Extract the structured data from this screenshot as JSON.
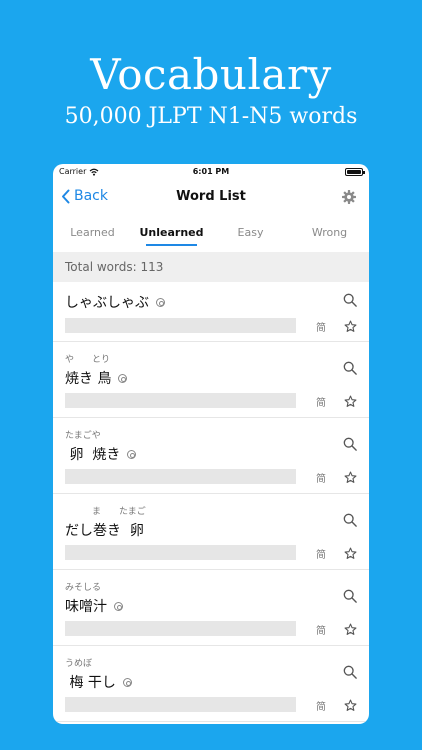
{
  "hero": {
    "title": "Vocabulary",
    "subtitle": "50,000 JLPT N1-N5 words"
  },
  "status": {
    "carrier": "Carrier",
    "time": "6:01 PM"
  },
  "navbar": {
    "back_label": "Back",
    "title": "Word List"
  },
  "tabs": [
    {
      "label": "Learned"
    },
    {
      "label": "Unlearned"
    },
    {
      "label": "Easy"
    },
    {
      "label": "Wrong"
    }
  ],
  "summary": {
    "total_text": "Total words: 113"
  },
  "words": [
    {
      "ruby": "",
      "word": "しゃぶしゃぶ",
      "pitch": "0",
      "kanji_label": "简"
    },
    {
      "ruby": "や　　とり",
      "word": "焼き 鳥",
      "pitch": "0",
      "kanji_label": "简"
    },
    {
      "ruby": "たまごや",
      "word": " 卵  焼き",
      "pitch": "0",
      "kanji_label": "简"
    },
    {
      "ruby": "　　　ま　　たまご",
      "word": "だし巻き  卵",
      "pitch": "",
      "kanji_label": "简"
    },
    {
      "ruby": "みそしる",
      "word": "味噌汁",
      "pitch": "3",
      "kanji_label": "简"
    },
    {
      "ruby": "うめぼ",
      "word": " 梅 干し",
      "pitch": "0",
      "kanji_label": "简"
    }
  ],
  "colors": {
    "background": "#1ba6ee",
    "accent": "#1e88e5"
  },
  "icons": {
    "back": "chevron-left-icon",
    "settings": "gear-icon",
    "search": "search-icon",
    "favorite": "star-outline-icon",
    "pitch": "pitch-accent-icon",
    "wifi": "wifi-icon",
    "battery": "battery-icon"
  }
}
